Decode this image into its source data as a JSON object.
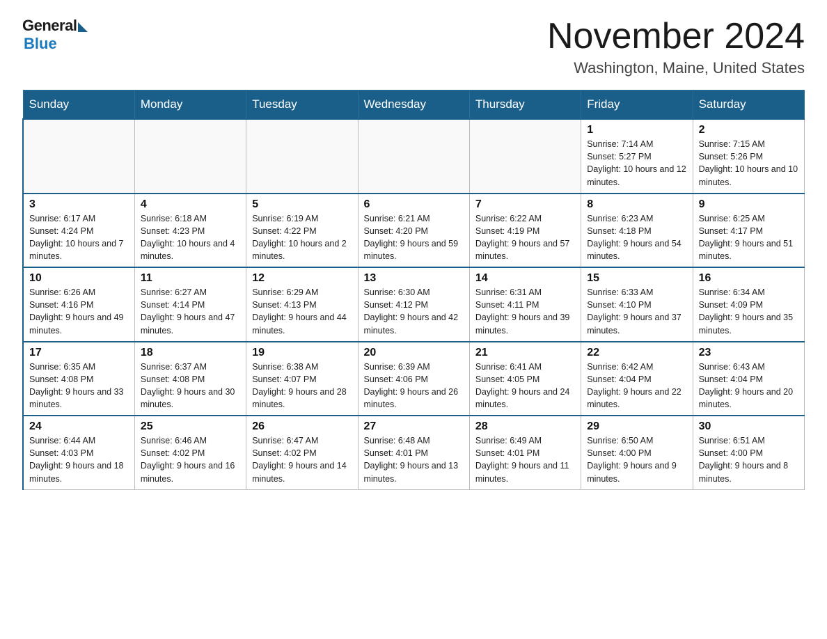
{
  "header": {
    "logo_general": "General",
    "logo_blue": "Blue",
    "month_title": "November 2024",
    "location": "Washington, Maine, United States"
  },
  "weekdays": [
    "Sunday",
    "Monday",
    "Tuesday",
    "Wednesday",
    "Thursday",
    "Friday",
    "Saturday"
  ],
  "rows": [
    [
      {
        "day": "",
        "sunrise": "",
        "sunset": "",
        "daylight": ""
      },
      {
        "day": "",
        "sunrise": "",
        "sunset": "",
        "daylight": ""
      },
      {
        "day": "",
        "sunrise": "",
        "sunset": "",
        "daylight": ""
      },
      {
        "day": "",
        "sunrise": "",
        "sunset": "",
        "daylight": ""
      },
      {
        "day": "",
        "sunrise": "",
        "sunset": "",
        "daylight": ""
      },
      {
        "day": "1",
        "sunrise": "Sunrise: 7:14 AM",
        "sunset": "Sunset: 5:27 PM",
        "daylight": "Daylight: 10 hours and 12 minutes."
      },
      {
        "day": "2",
        "sunrise": "Sunrise: 7:15 AM",
        "sunset": "Sunset: 5:26 PM",
        "daylight": "Daylight: 10 hours and 10 minutes."
      }
    ],
    [
      {
        "day": "3",
        "sunrise": "Sunrise: 6:17 AM",
        "sunset": "Sunset: 4:24 PM",
        "daylight": "Daylight: 10 hours and 7 minutes."
      },
      {
        "day": "4",
        "sunrise": "Sunrise: 6:18 AM",
        "sunset": "Sunset: 4:23 PM",
        "daylight": "Daylight: 10 hours and 4 minutes."
      },
      {
        "day": "5",
        "sunrise": "Sunrise: 6:19 AM",
        "sunset": "Sunset: 4:22 PM",
        "daylight": "Daylight: 10 hours and 2 minutes."
      },
      {
        "day": "6",
        "sunrise": "Sunrise: 6:21 AM",
        "sunset": "Sunset: 4:20 PM",
        "daylight": "Daylight: 9 hours and 59 minutes."
      },
      {
        "day": "7",
        "sunrise": "Sunrise: 6:22 AM",
        "sunset": "Sunset: 4:19 PM",
        "daylight": "Daylight: 9 hours and 57 minutes."
      },
      {
        "day": "8",
        "sunrise": "Sunrise: 6:23 AM",
        "sunset": "Sunset: 4:18 PM",
        "daylight": "Daylight: 9 hours and 54 minutes."
      },
      {
        "day": "9",
        "sunrise": "Sunrise: 6:25 AM",
        "sunset": "Sunset: 4:17 PM",
        "daylight": "Daylight: 9 hours and 51 minutes."
      }
    ],
    [
      {
        "day": "10",
        "sunrise": "Sunrise: 6:26 AM",
        "sunset": "Sunset: 4:16 PM",
        "daylight": "Daylight: 9 hours and 49 minutes."
      },
      {
        "day": "11",
        "sunrise": "Sunrise: 6:27 AM",
        "sunset": "Sunset: 4:14 PM",
        "daylight": "Daylight: 9 hours and 47 minutes."
      },
      {
        "day": "12",
        "sunrise": "Sunrise: 6:29 AM",
        "sunset": "Sunset: 4:13 PM",
        "daylight": "Daylight: 9 hours and 44 minutes."
      },
      {
        "day": "13",
        "sunrise": "Sunrise: 6:30 AM",
        "sunset": "Sunset: 4:12 PM",
        "daylight": "Daylight: 9 hours and 42 minutes."
      },
      {
        "day": "14",
        "sunrise": "Sunrise: 6:31 AM",
        "sunset": "Sunset: 4:11 PM",
        "daylight": "Daylight: 9 hours and 39 minutes."
      },
      {
        "day": "15",
        "sunrise": "Sunrise: 6:33 AM",
        "sunset": "Sunset: 4:10 PM",
        "daylight": "Daylight: 9 hours and 37 minutes."
      },
      {
        "day": "16",
        "sunrise": "Sunrise: 6:34 AM",
        "sunset": "Sunset: 4:09 PM",
        "daylight": "Daylight: 9 hours and 35 minutes."
      }
    ],
    [
      {
        "day": "17",
        "sunrise": "Sunrise: 6:35 AM",
        "sunset": "Sunset: 4:08 PM",
        "daylight": "Daylight: 9 hours and 33 minutes."
      },
      {
        "day": "18",
        "sunrise": "Sunrise: 6:37 AM",
        "sunset": "Sunset: 4:08 PM",
        "daylight": "Daylight: 9 hours and 30 minutes."
      },
      {
        "day": "19",
        "sunrise": "Sunrise: 6:38 AM",
        "sunset": "Sunset: 4:07 PM",
        "daylight": "Daylight: 9 hours and 28 minutes."
      },
      {
        "day": "20",
        "sunrise": "Sunrise: 6:39 AM",
        "sunset": "Sunset: 4:06 PM",
        "daylight": "Daylight: 9 hours and 26 minutes."
      },
      {
        "day": "21",
        "sunrise": "Sunrise: 6:41 AM",
        "sunset": "Sunset: 4:05 PM",
        "daylight": "Daylight: 9 hours and 24 minutes."
      },
      {
        "day": "22",
        "sunrise": "Sunrise: 6:42 AM",
        "sunset": "Sunset: 4:04 PM",
        "daylight": "Daylight: 9 hours and 22 minutes."
      },
      {
        "day": "23",
        "sunrise": "Sunrise: 6:43 AM",
        "sunset": "Sunset: 4:04 PM",
        "daylight": "Daylight: 9 hours and 20 minutes."
      }
    ],
    [
      {
        "day": "24",
        "sunrise": "Sunrise: 6:44 AM",
        "sunset": "Sunset: 4:03 PM",
        "daylight": "Daylight: 9 hours and 18 minutes."
      },
      {
        "day": "25",
        "sunrise": "Sunrise: 6:46 AM",
        "sunset": "Sunset: 4:02 PM",
        "daylight": "Daylight: 9 hours and 16 minutes."
      },
      {
        "day": "26",
        "sunrise": "Sunrise: 6:47 AM",
        "sunset": "Sunset: 4:02 PM",
        "daylight": "Daylight: 9 hours and 14 minutes."
      },
      {
        "day": "27",
        "sunrise": "Sunrise: 6:48 AM",
        "sunset": "Sunset: 4:01 PM",
        "daylight": "Daylight: 9 hours and 13 minutes."
      },
      {
        "day": "28",
        "sunrise": "Sunrise: 6:49 AM",
        "sunset": "Sunset: 4:01 PM",
        "daylight": "Daylight: 9 hours and 11 minutes."
      },
      {
        "day": "29",
        "sunrise": "Sunrise: 6:50 AM",
        "sunset": "Sunset: 4:00 PM",
        "daylight": "Daylight: 9 hours and 9 minutes."
      },
      {
        "day": "30",
        "sunrise": "Sunrise: 6:51 AM",
        "sunset": "Sunset: 4:00 PM",
        "daylight": "Daylight: 9 hours and 8 minutes."
      }
    ]
  ]
}
